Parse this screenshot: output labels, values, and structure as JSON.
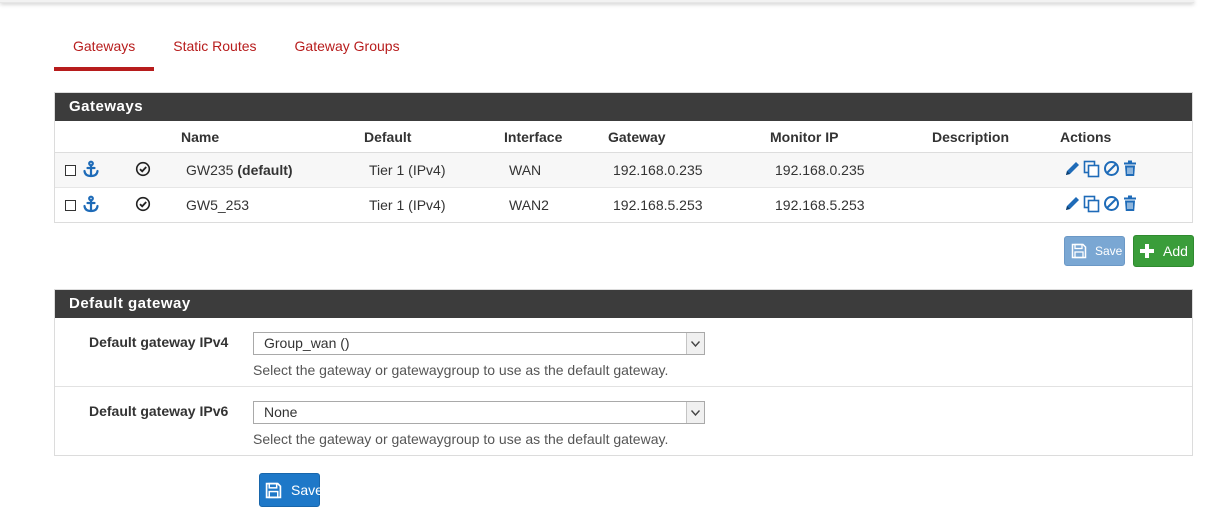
{
  "tabs": [
    {
      "label": "Gateways",
      "active": true
    },
    {
      "label": "Static Routes",
      "active": false
    },
    {
      "label": "Gateway Groups",
      "active": false
    }
  ],
  "gateways_panel": {
    "title": "Gateways",
    "columns": [
      "Name",
      "Default",
      "Interface",
      "Gateway",
      "Monitor IP",
      "Description",
      "Actions"
    ],
    "rows": [
      {
        "name": "GW235",
        "name_suffix": "(default)",
        "default": "Tier 1 (IPv4)",
        "interface": "WAN",
        "gateway": "192.168.0.235",
        "monitor_ip": "192.168.0.235",
        "description": ""
      },
      {
        "name": "GW5_253",
        "name_suffix": "",
        "default": "Tier 1 (IPv4)",
        "interface": "WAN2",
        "gateway": "192.168.5.253",
        "monitor_ip": "192.168.5.253",
        "description": ""
      }
    ],
    "save_label": "Save",
    "add_label": "Add"
  },
  "default_gateway_panel": {
    "title": "Default gateway",
    "ipv4": {
      "label": "Default gateway IPv4",
      "selected": "Group_wan ()",
      "help": "Select the gateway or gatewaygroup to use as the default gateway."
    },
    "ipv6": {
      "label": "Default gateway IPv6",
      "selected": "None",
      "help": "Select the gateway or gatewaygroup to use as the default gateway."
    }
  },
  "save_label": "Save",
  "colors": {
    "tab_accent": "#b71c1c",
    "panel_heading": "#3c3c3c",
    "icon_blue": "#1e6bb8",
    "add_green": "#3a9d3a",
    "save_blue": "#1e78c8"
  },
  "icons": [
    "anchor-icon",
    "check-circle-icon",
    "pencil-icon",
    "copy-icon",
    "disable-icon",
    "trash-icon",
    "save-icon",
    "plus-icon",
    "chevron-down-icon"
  ]
}
